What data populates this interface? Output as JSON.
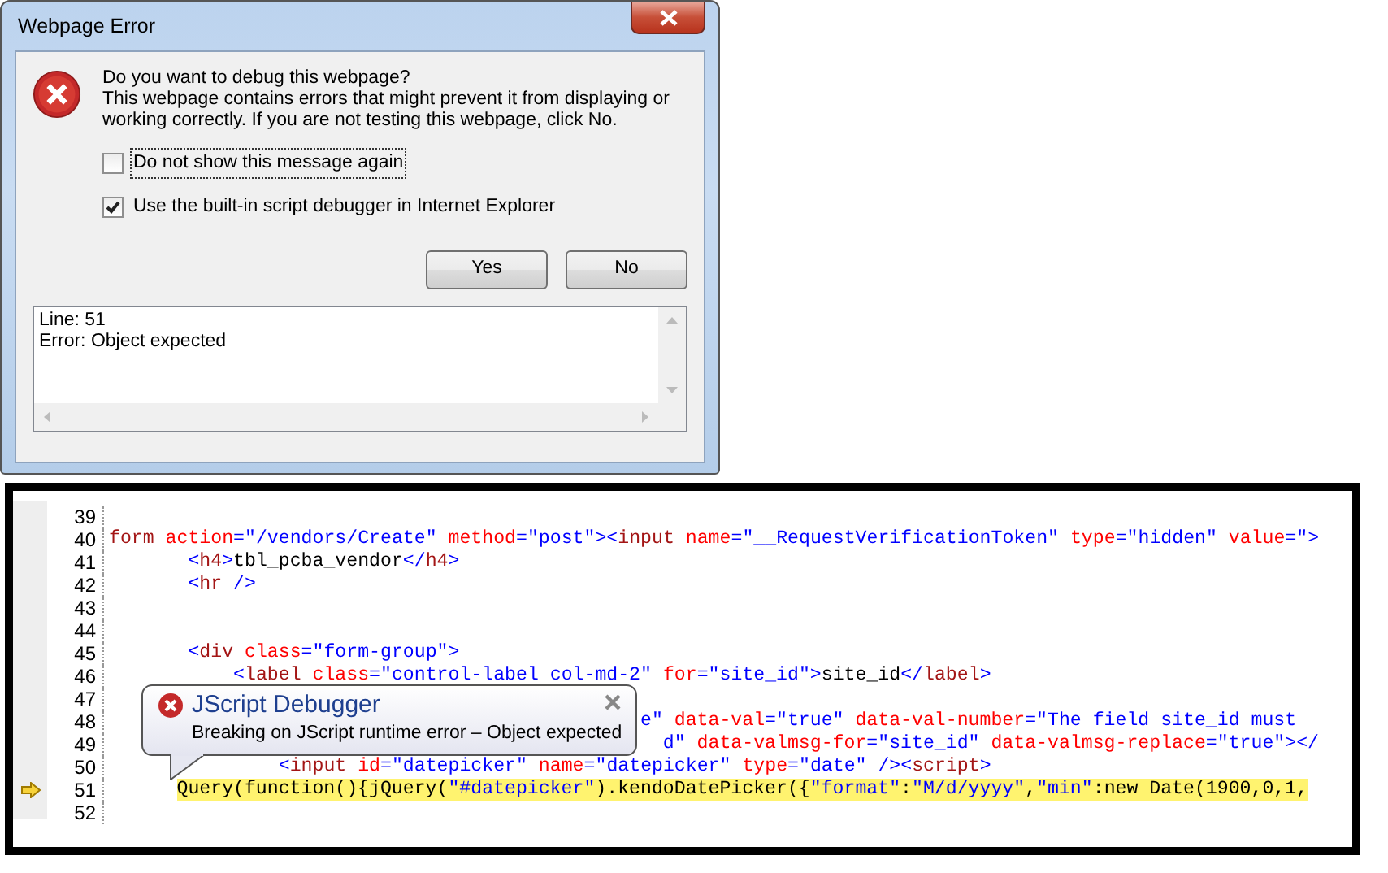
{
  "dialog": {
    "title": "Webpage Error",
    "question": "Do you want to debug this webpage?",
    "message": "This webpage contains errors that might prevent it from displaying or working correctly. If you are not testing this webpage, click No.",
    "checkboxes": [
      {
        "label": "Do not show this message again",
        "checked": false,
        "focused": true
      },
      {
        "label": "Use the built-in script debugger in Internet Explorer",
        "checked": true,
        "focused": false
      }
    ],
    "buttons": [
      "Yes",
      "No"
    ],
    "details": [
      "Line: 51",
      "Error: Object expected"
    ]
  },
  "debugger": {
    "lines": [
      {
        "number": "39",
        "current": false
      },
      {
        "number": "40",
        "current": false,
        "segments": [
          {
            "kind": "tag",
            "text": "form"
          },
          {
            "kind": "attr",
            "text": " action"
          },
          {
            "kind": "punct",
            "text": "="
          },
          {
            "kind": "value",
            "text": "\"/vendors/Create\""
          },
          {
            "kind": "attr",
            "text": " method"
          },
          {
            "kind": "punct",
            "text": "="
          },
          {
            "kind": "value",
            "text": "\"post\""
          },
          {
            "kind": "punct",
            "text": "><"
          },
          {
            "kind": "tag",
            "text": "input"
          },
          {
            "kind": "attr",
            "text": " name"
          },
          {
            "kind": "punct",
            "text": "="
          },
          {
            "kind": "value",
            "text": "\"__RequestVerificationToken\""
          },
          {
            "kind": "attr",
            "text": " type"
          },
          {
            "kind": "punct",
            "text": "="
          },
          {
            "kind": "value",
            "text": "\"hidden\""
          },
          {
            "kind": "attr",
            "text": " value"
          },
          {
            "kind": "punct",
            "text": "="
          },
          {
            "kind": "value",
            "text": "\">"
          }
        ]
      },
      {
        "number": "41",
        "current": false,
        "segments": [
          {
            "kind": "punct",
            "text": "       <"
          },
          {
            "kind": "tag",
            "text": "h4"
          },
          {
            "kind": "punct",
            "text": ">"
          },
          {
            "kind": "text",
            "text": "tbl_pcba_vendor"
          },
          {
            "kind": "punct",
            "text": "</"
          },
          {
            "kind": "tag",
            "text": "h4"
          },
          {
            "kind": "punct",
            "text": ">"
          }
        ]
      },
      {
        "number": "42",
        "current": false,
        "segments": [
          {
            "kind": "punct",
            "text": "       <"
          },
          {
            "kind": "tag",
            "text": "hr"
          },
          {
            "kind": "punct",
            "text": " />"
          }
        ]
      },
      {
        "number": "43",
        "current": false
      },
      {
        "number": "44",
        "current": false
      },
      {
        "number": "45",
        "current": false,
        "segments": [
          {
            "kind": "punct",
            "text": "       <"
          },
          {
            "kind": "tag",
            "text": "div"
          },
          {
            "kind": "attr",
            "text": " class"
          },
          {
            "kind": "punct",
            "text": "="
          },
          {
            "kind": "value",
            "text": "\"form-group\""
          },
          {
            "kind": "punct",
            "text": ">"
          }
        ]
      },
      {
        "number": "46",
        "current": false,
        "segments": [
          {
            "kind": "punct",
            "text": "           <"
          },
          {
            "kind": "tag",
            "text": "label"
          },
          {
            "kind": "attr",
            "text": " class"
          },
          {
            "kind": "punct",
            "text": "="
          },
          {
            "kind": "value",
            "text": "\"control-label col-md-2\""
          },
          {
            "kind": "attr",
            "text": " for"
          },
          {
            "kind": "punct",
            "text": "="
          },
          {
            "kind": "value",
            "text": "\"site_id\""
          },
          {
            "kind": "punct",
            "text": ">"
          },
          {
            "kind": "text",
            "text": "site_id"
          },
          {
            "kind": "punct",
            "text": "</"
          },
          {
            "kind": "tag",
            "text": "label"
          },
          {
            "kind": "punct",
            "text": ">"
          }
        ]
      },
      {
        "number": "47",
        "current": false
      },
      {
        "number": "48",
        "current": false,
        "segments": [
          {
            "kind": "value",
            "text": "                                               e\""
          },
          {
            "kind": "attr",
            "text": " data-val"
          },
          {
            "kind": "punct",
            "text": "="
          },
          {
            "kind": "value",
            "text": "\"true\""
          },
          {
            "kind": "attr",
            "text": " data-val-number"
          },
          {
            "kind": "punct",
            "text": "="
          },
          {
            "kind": "value",
            "text": "\"The field site_id must"
          }
        ]
      },
      {
        "number": "49",
        "current": false,
        "segments": [
          {
            "kind": "value",
            "text": "                                                 d\""
          },
          {
            "kind": "attr",
            "text": " data-valmsg-for"
          },
          {
            "kind": "punct",
            "text": "="
          },
          {
            "kind": "value",
            "text": "\"site_id\""
          },
          {
            "kind": "attr",
            "text": " data-valmsg-replace"
          },
          {
            "kind": "punct",
            "text": "="
          },
          {
            "kind": "value",
            "text": "\"true\""
          },
          {
            "kind": "punct",
            "text": "></"
          }
        ]
      },
      {
        "number": "50",
        "current": false,
        "segments": [
          {
            "kind": "punct",
            "text": "               <"
          },
          {
            "kind": "tag",
            "text": "input"
          },
          {
            "kind": "attr",
            "text": " id"
          },
          {
            "kind": "punct",
            "text": "="
          },
          {
            "kind": "value",
            "text": "\"datepicker\""
          },
          {
            "kind": "attr",
            "text": " name"
          },
          {
            "kind": "punct",
            "text": "="
          },
          {
            "kind": "value",
            "text": "\"datepicker\""
          },
          {
            "kind": "attr",
            "text": " type"
          },
          {
            "kind": "punct",
            "text": "="
          },
          {
            "kind": "value",
            "text": "\"date\""
          },
          {
            "kind": "punct",
            "text": " /><"
          },
          {
            "kind": "tag",
            "text": "script"
          },
          {
            "kind": "punct",
            "text": ">"
          }
        ]
      },
      {
        "number": "51",
        "current": true,
        "segments": [
          {
            "kind": "text",
            "text": "      Query(function(){jQuery("
          },
          {
            "kind": "value",
            "text": "\"#datepicker\""
          },
          {
            "kind": "text",
            "text": ").kendoDatePicker({"
          },
          {
            "kind": "value",
            "text": "\"format\""
          },
          {
            "kind": "text",
            "text": ":"
          },
          {
            "kind": "value",
            "text": "\"M/d/yyyy\""
          },
          {
            "kind": "text",
            "text": ","
          },
          {
            "kind": "value",
            "text": "\"min\""
          },
          {
            "kind": "text",
            "text": ":new Date(1900,0,1,"
          }
        ]
      },
      {
        "number": "52",
        "current": false
      }
    ],
    "tooltip": {
      "title": "JScript Debugger",
      "message": "Breaking on JScript runtime error – Object expected"
    }
  }
}
